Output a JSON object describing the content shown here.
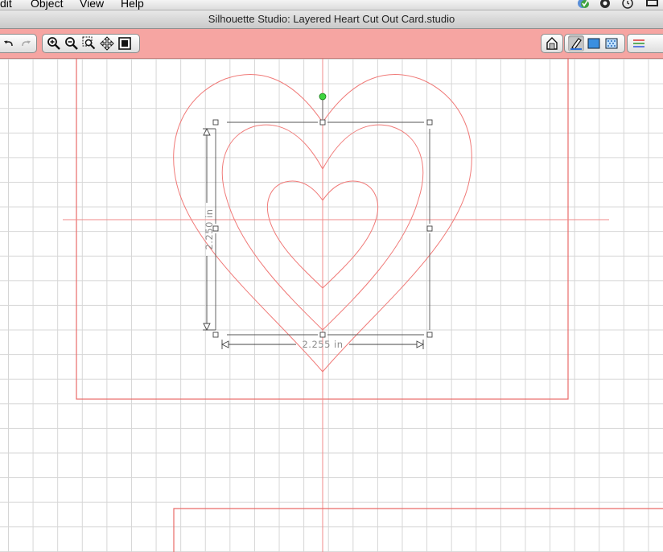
{
  "menubar": {
    "items": [
      {
        "label": "dit"
      },
      {
        "label": "Object"
      },
      {
        "label": "View"
      },
      {
        "label": "Help"
      }
    ]
  },
  "window": {
    "title": "Silhouette Studio: Layered Heart Cut Out Card.studio"
  },
  "toolbar": {
    "left_groups": [
      [
        "undo-icon",
        "redo-icon"
      ],
      [
        "zoom-in-icon",
        "zoom-out-icon",
        "zoom-selection-icon",
        "pan-icon",
        "fit-to-page-icon"
      ]
    ],
    "right_groups": [
      [
        "design-page-icon"
      ],
      [
        "line-color-icon",
        "fill-color-icon",
        "fill-pattern-icon"
      ],
      [
        "line-style-icon"
      ]
    ],
    "accent_color": "#f6a5a2"
  },
  "canvas": {
    "grid_color": "#d6d6d6",
    "cut_line_color": "#f07a78",
    "selection_handle_color": "#555555",
    "rotate_handle_color": "#3ed43e",
    "selection": {
      "height_label": "2.250 in",
      "width_label": "2.255 in"
    }
  }
}
